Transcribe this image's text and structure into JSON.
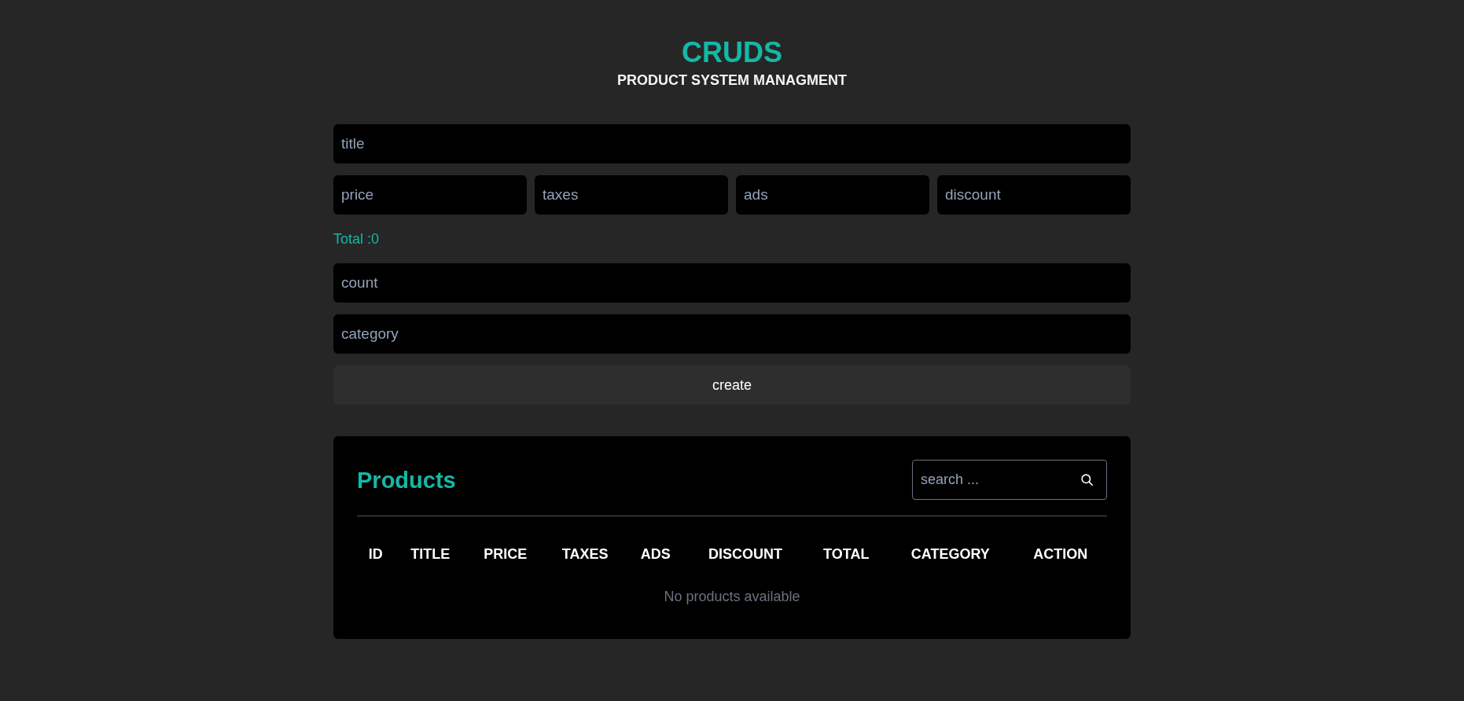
{
  "header": {
    "title": "CRUDS",
    "subtitle": "PRODUCT SYSTEM MANAGMENT"
  },
  "form": {
    "title_field": {
      "placeholder": "title"
    },
    "cost_fields": [
      {
        "placeholder": "price"
      },
      {
        "placeholder": "taxes"
      },
      {
        "placeholder": "ads"
      },
      {
        "placeholder": "discount"
      }
    ],
    "total": "Total :0",
    "count_field": {
      "placeholder": "count"
    },
    "category_field": {
      "placeholder": "category"
    },
    "create_button": "create"
  },
  "products": {
    "heading": "Products",
    "search": {
      "placeholder": "search ..."
    },
    "table": {
      "columns": [
        "ID",
        "TITLE",
        "PRICE",
        "TAXES",
        "ADS",
        "DISCOUNT",
        "TOTAL",
        "CATEGORY",
        "ACTION"
      ],
      "empty_message": "No products available"
    }
  }
}
